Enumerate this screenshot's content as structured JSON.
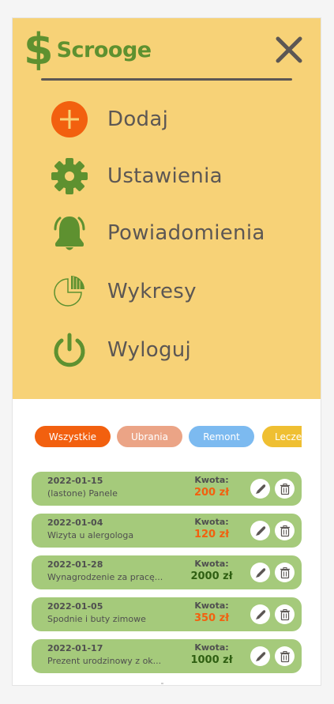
{
  "app": {
    "logo_symbol": "$",
    "logo_text": "Scrooge",
    "close_icon": "close-icon",
    "brand_green": "#5e9130",
    "menu_bg": "#f7d277"
  },
  "menu": {
    "items": [
      {
        "label": "Dodaj",
        "icon": "plus-circle-icon"
      },
      {
        "label": "Ustawienia",
        "icon": "gear-icon"
      },
      {
        "label": "Powiadomienia",
        "icon": "bell-icon"
      },
      {
        "label": "Wykresy",
        "icon": "pie-chart-icon"
      },
      {
        "label": "Wyloguj",
        "icon": "power-icon"
      }
    ]
  },
  "filters": [
    {
      "label": "Wszystkie",
      "color": "#f2600f",
      "active": true
    },
    {
      "label": "Ubrania",
      "color": "#eba486",
      "active": false
    },
    {
      "label": "Remont",
      "color": "#7cbaf0",
      "active": false
    },
    {
      "label": "Lecze",
      "color": "#efbf32",
      "active": false
    }
  ],
  "entries_label": "Kwota:",
  "entries": [
    {
      "date": "2022-01-15",
      "description": "(lastone) Panele",
      "amount": "200 zł",
      "type": "expense"
    },
    {
      "date": "2022-01-04",
      "description": "Wizyta u alergologa",
      "amount": "120 zł",
      "type": "expense"
    },
    {
      "date": "2022-01-28",
      "description": "Wynagrodzenie za pracę...",
      "amount": "2000 zł",
      "type": "income"
    },
    {
      "date": "2022-01-05",
      "description": "Spodnie i buty zimowe",
      "amount": "350 zł",
      "type": "expense"
    },
    {
      "date": "2022-01-17",
      "description": "Prezent urodzinowy z ok...",
      "amount": "1000 zł",
      "type": "income"
    }
  ],
  "colors": {
    "expense": "#f2600f",
    "income": "#2f5f12"
  }
}
